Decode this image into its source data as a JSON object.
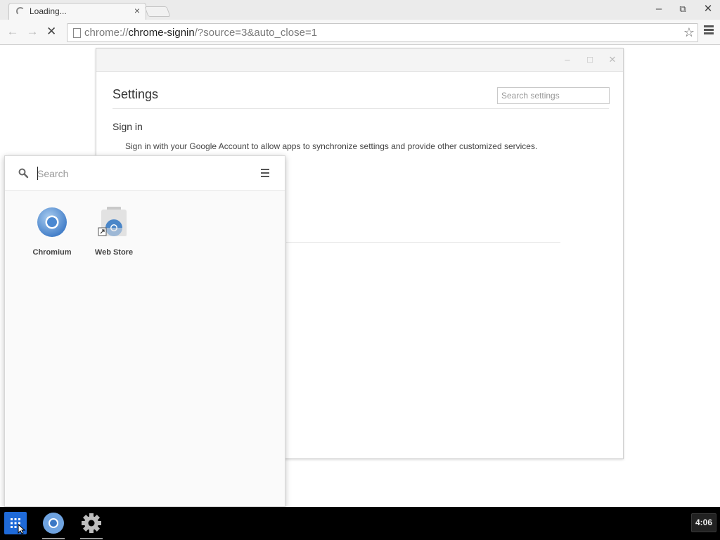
{
  "browser": {
    "tab_title": "Loading...",
    "tab_close": "×",
    "url_scheme": "chrome://",
    "url_host": "chrome-signin",
    "url_path": "/?source=3&auto_close=1"
  },
  "settings_window": {
    "title": "Settings",
    "search_placeholder": "Search settings",
    "section_title": "Sign in",
    "description": "Sign in with your Google Account to allow apps to synchronize settings and provide other customized services."
  },
  "launcher": {
    "search_placeholder": "Search",
    "apps": [
      {
        "label": "Chromium",
        "icon": "chromium-icon"
      },
      {
        "label": "Web Store",
        "icon": "web-store-icon"
      }
    ]
  },
  "shelf": {
    "items": [
      "app-launcher-icon",
      "chromium-icon",
      "settings-gear-icon"
    ],
    "clock": "4:06"
  },
  "colors": {
    "launcher_button": "#1f6ad8",
    "shelf_background": "#000000",
    "chromium_blue": "#3b78c5"
  }
}
